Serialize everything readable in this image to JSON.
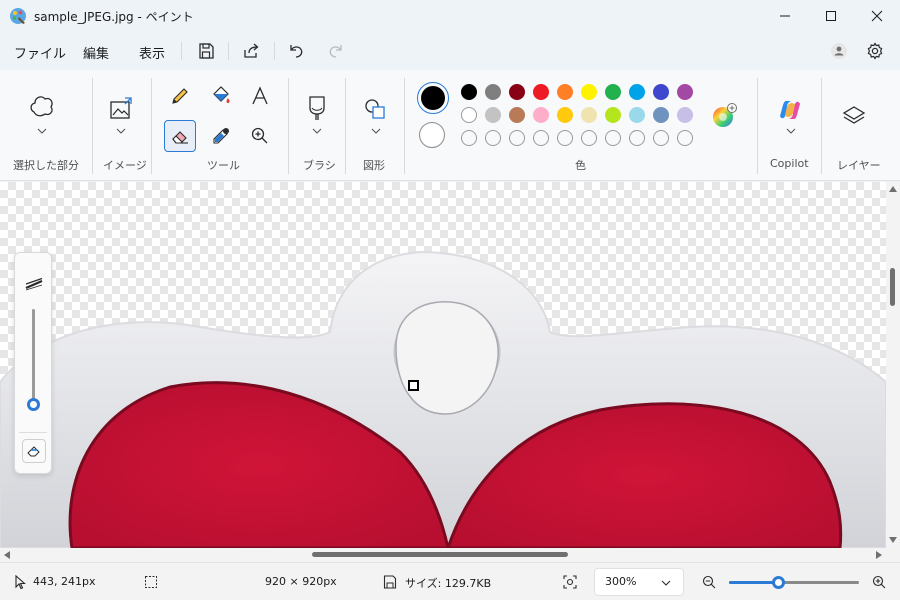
{
  "window": {
    "title": "sample_JPEG.jpg - ペイント",
    "minimize_icon": "minimize-icon",
    "maximize_icon": "maximize-icon",
    "close_icon": "close-icon"
  },
  "menubar": {
    "file_label": "ファイル",
    "edit_label": "編集",
    "view_label": "表示",
    "icons": [
      "save-icon",
      "share-icon",
      "undo-icon",
      "redo-icon",
      "account-icon",
      "settings-icon"
    ]
  },
  "ribbon": {
    "selection_label": "選択した部分",
    "image_label": "イメージ",
    "tools_label": "ツール",
    "brush_label": "ブラシ",
    "shapes_label": "図形",
    "colors_label": "色",
    "copilot_label": "Copilot",
    "layers_label": "レイヤー",
    "tools": [
      "pencil-icon",
      "fill-icon",
      "text-icon",
      "eraser-icon",
      "color-picker-icon",
      "magnifier-icon"
    ],
    "primary_color": "#000000",
    "secondary_color": "#ffffff",
    "palette_row1": [
      "#000000",
      "#7f7f7f",
      "#880015",
      "#ed1c24",
      "#ff7f27",
      "#fff200",
      "#22b14c",
      "#00a2e8",
      "#3f48cc",
      "#a349a4"
    ],
    "palette_row2": [
      "#ffffff",
      "#c3c3c3",
      "#b97a57",
      "#ffaec9",
      "#ffc90e",
      "#efe4b0",
      "#b5e61d",
      "#99d9ea",
      "#7092be",
      "#c8bfe7"
    ],
    "palette_row3_count": 10
  },
  "canvas": {
    "brush_size_level": 0.05
  },
  "status": {
    "cursor_position": "443, 241px",
    "canvas_size": "920 × 920px",
    "file_size": "サイズ: 129.7KB",
    "zoom": "300%",
    "zoom_slider_level": 0.38
  }
}
